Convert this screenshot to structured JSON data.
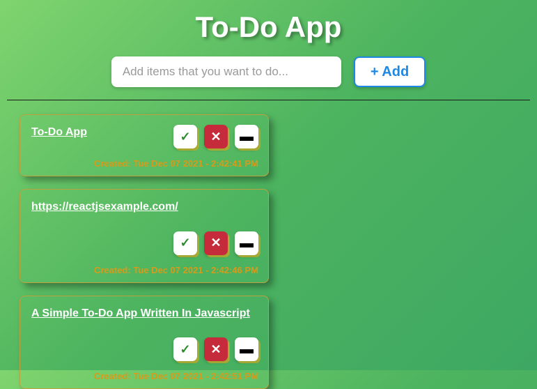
{
  "header": {
    "title": "To-Do App"
  },
  "input": {
    "placeholder": "Add items that you want to do...",
    "value": ""
  },
  "buttons": {
    "add": "+ Add"
  },
  "todos": [
    {
      "title": "To-Do  App",
      "created": "Created: Tue Dec 07 2021 - 2:42:41 PM"
    },
    {
      "title": "https://reactjsexample.com/",
      "created": "Created: Tue Dec 07 2021 - 2:42:46 PM"
    },
    {
      "title": "A Simple To-Do App Written In Javascript",
      "created": "Created: Tue Dec 07 2021 - 2:42:51 PM"
    }
  ]
}
